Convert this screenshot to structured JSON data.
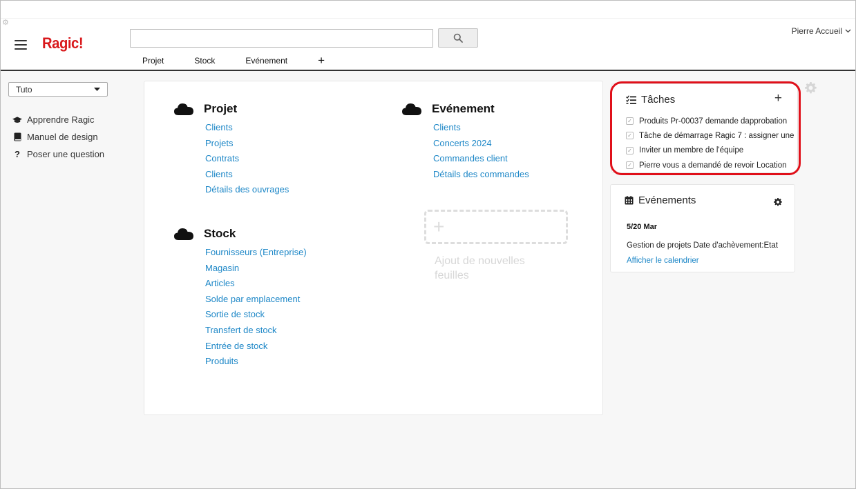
{
  "header": {
    "logo": "Ragic!",
    "search": {
      "value": "",
      "placeholder": ""
    },
    "user": "Pierre Accueil",
    "tabs": [
      "Projet",
      "Stock",
      "Evénement"
    ],
    "tab_add": "+"
  },
  "sidebar": {
    "selected": "Tuto",
    "links": [
      {
        "label": "Apprendre Ragic",
        "icon": "graduation-cap-icon"
      },
      {
        "label": "Manuel de design",
        "icon": "book-icon"
      },
      {
        "label": "Poser une question",
        "icon": "question-icon"
      }
    ]
  },
  "groups": [
    {
      "title": "Projet",
      "links": [
        "Clients",
        "Projets",
        "Contrats",
        "Clients",
        "Détails des ouvrages"
      ]
    },
    {
      "title": "Evénement",
      "links": [
        "Clients",
        "Concerts 2024",
        "Commandes client",
        "Détails des commandes"
      ]
    },
    {
      "title": "Stock",
      "links": [
        "Fournisseurs (Entreprise)",
        "Magasin",
        "Articles",
        "Solde par emplacement",
        "Sortie de stock",
        "Transfert de stock",
        "Entrée de stock",
        "Produits"
      ]
    }
  ],
  "add_sheet": {
    "label": "Ajout de nouvelles feuilles"
  },
  "tasks": {
    "title": "Tâches",
    "add": "+",
    "items": [
      "Produits Pr-00037 demande dapprobation",
      "Tâche de démarrage Ragic 7 : assigner une",
      "Inviter un membre de l'équipe",
      "Pierre vous a demandé de revoir Location"
    ]
  },
  "events": {
    "title": "Evénements",
    "date": "5/20 Mar",
    "item": "Gestion de projets Date d'achèvement:Etat",
    "calendar_link": "Afficher le calendrier"
  },
  "colors": {
    "accent": "#d9191c",
    "link": "#1d87c7",
    "highlight": "#e0101a"
  }
}
